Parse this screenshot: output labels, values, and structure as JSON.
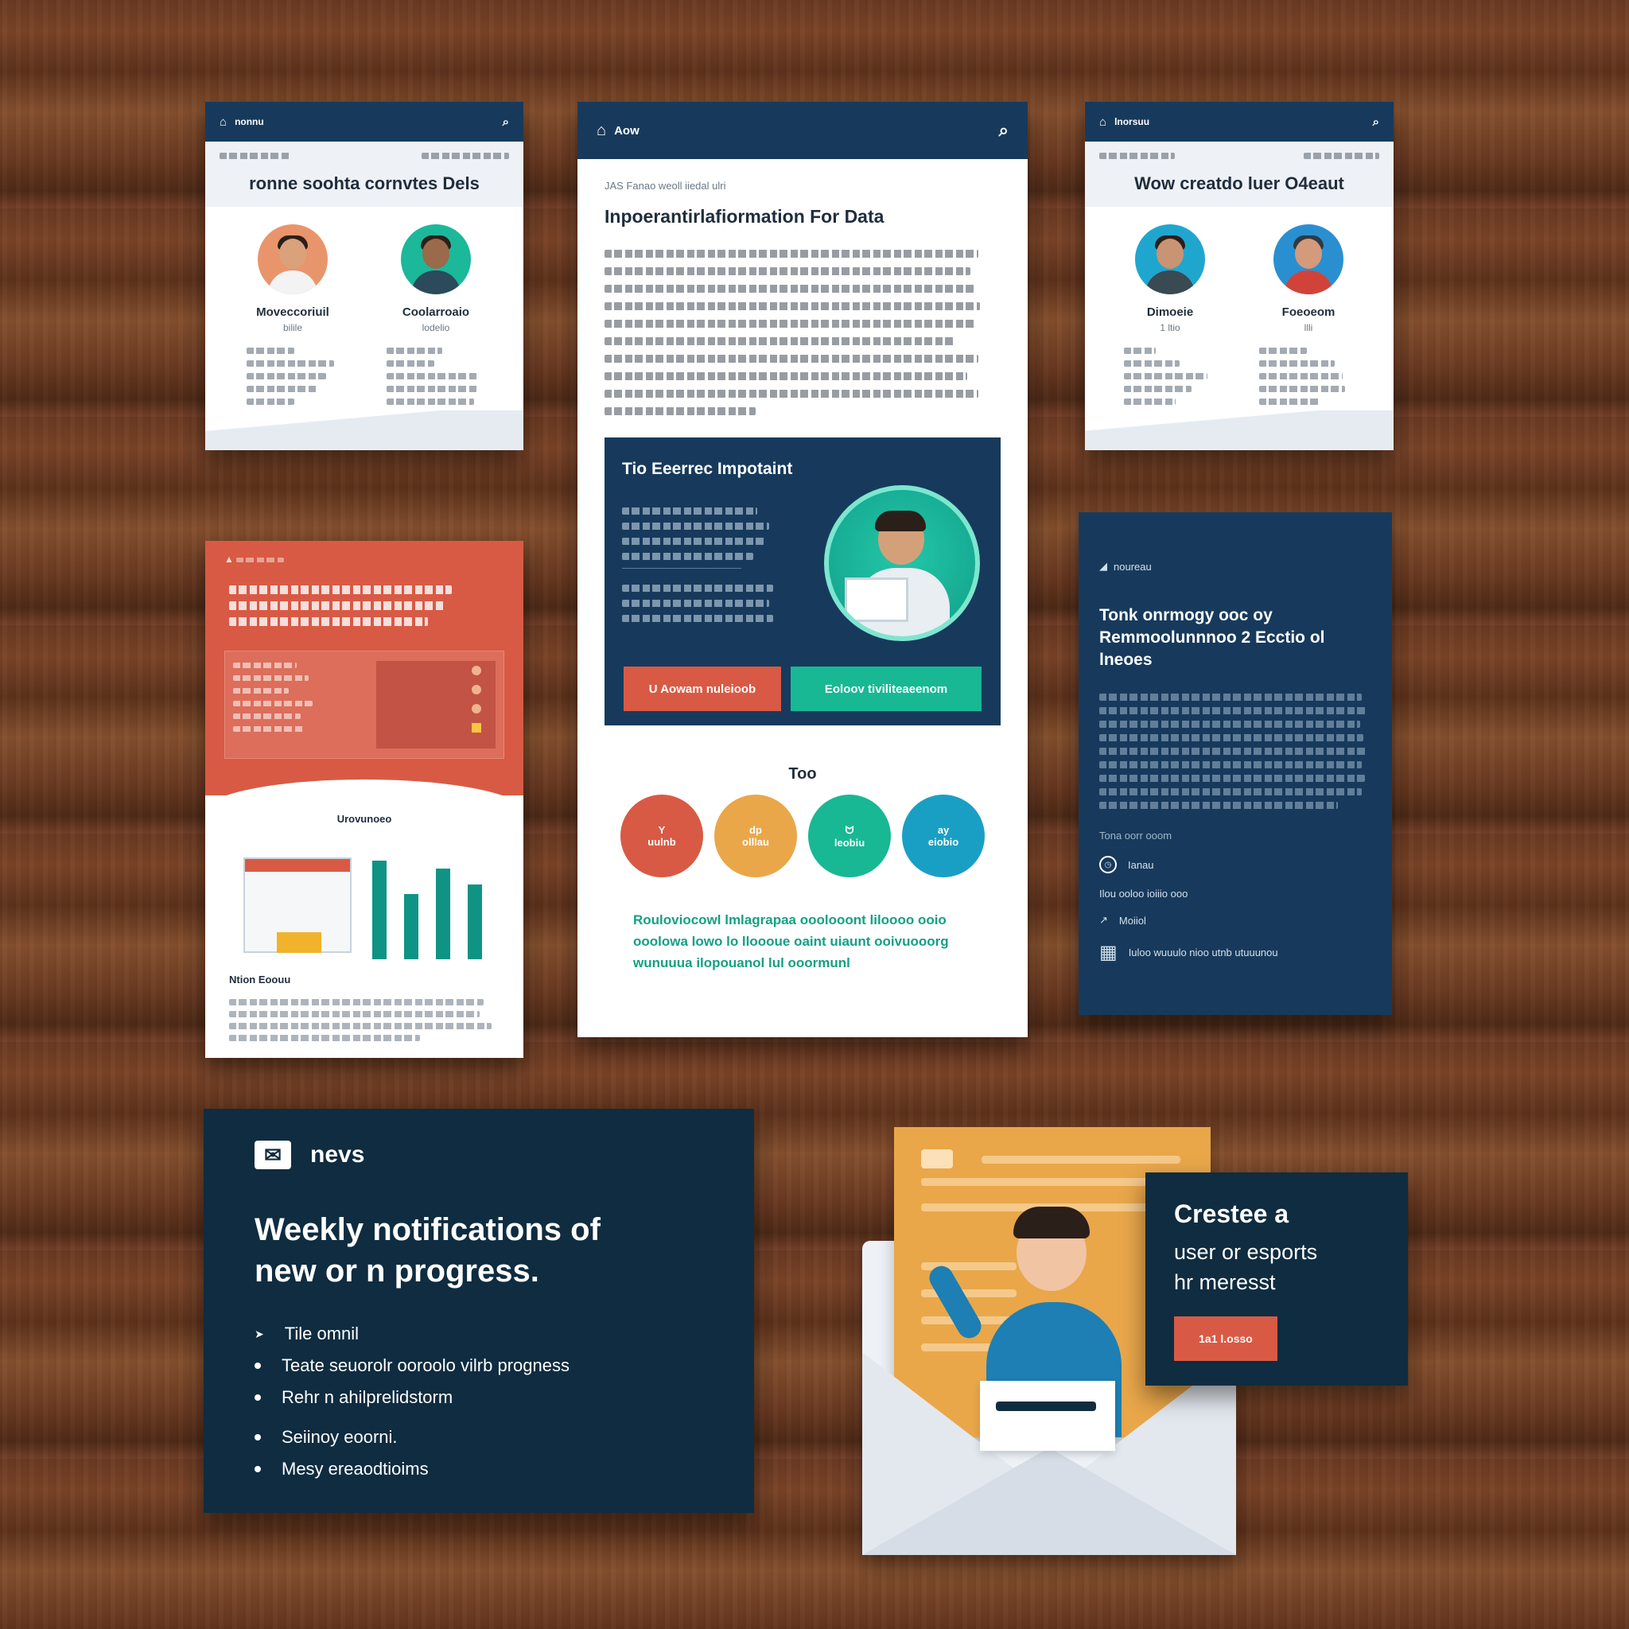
{
  "cards": {
    "left_profile": {
      "nav_label": "nonnu",
      "title": "ronne soohta cornvtes Dels",
      "people": [
        {
          "name": "Moveccoriuil",
          "role": "bilile"
        },
        {
          "name": "Coolarroaio",
          "role": "lodelio"
        }
      ]
    },
    "center_article": {
      "nav_label": "Aow",
      "crumb": "JAS Fanao weoll iiedal ulri",
      "title": "Inpoerantirlafiormation For Data",
      "feature": {
        "title": "Tio Eeerrec Impotaint",
        "button_primary": "U Aowam nuleioob",
        "button_secondary": "Eoloov tiviliteaeenom"
      },
      "section_title": "Too",
      "circles": [
        {
          "glyph": "Y",
          "label": "uulnb",
          "color": "#d85a45"
        },
        {
          "glyph": "dp",
          "label": "olllau",
          "color": "#e9a74a"
        },
        {
          "glyph": "ᗢ",
          "label": "leobiu",
          "color": "#18b894"
        },
        {
          "glyph": "ay",
          "label": "eiobio",
          "color": "#1a9fc4"
        }
      ],
      "teal_paragraph": "Rouloviocowl lmlagrapaa ooolooont liloooo ooio ooolowa lowo lo lloooue oaint uiaunt ooivuooorg wunuuua ilopouanol lul ooormunl"
    },
    "right_profile": {
      "nav_label": "lnorsuu",
      "title": "Wow creatdo luer O4eaut",
      "people": [
        {
          "name": "Dimoeie",
          "role": "1 ltio"
        },
        {
          "name": "Foeoeom",
          "role": "llli"
        }
      ]
    },
    "dark_right": {
      "tag": "noureau",
      "title": "Tonk onrmogy ooc oy Remmoolunnnoo 2 Ecctio ol lneoes",
      "footer_label": "Tona oorr ooom",
      "rows": [
        "Ianau",
        "Ilou ooloo ioiiio ooo",
        "Moiiol",
        "Iuloo wuuulo nioo utnb utuuunou"
      ]
    },
    "red_card": {
      "chart_label": "Urovunoeo",
      "caption": "Ntion Eoouu"
    }
  },
  "newsletter": {
    "brand": "nevs",
    "headline_line1": "Weekly notifications of",
    "headline_line2": "new or n progress.",
    "bullets": [
      "Tile omnil",
      "Teate seuorolr ooroolo vilrb progness",
      "Rehr n ahilprelidstorm",
      "Seiinoy eoorni.",
      "Mesy ereaodtioims"
    ]
  },
  "cta": {
    "title": "Crestee a",
    "line2": "user or esports",
    "line3": "hr meresst",
    "button": "1a1 l.osso"
  }
}
